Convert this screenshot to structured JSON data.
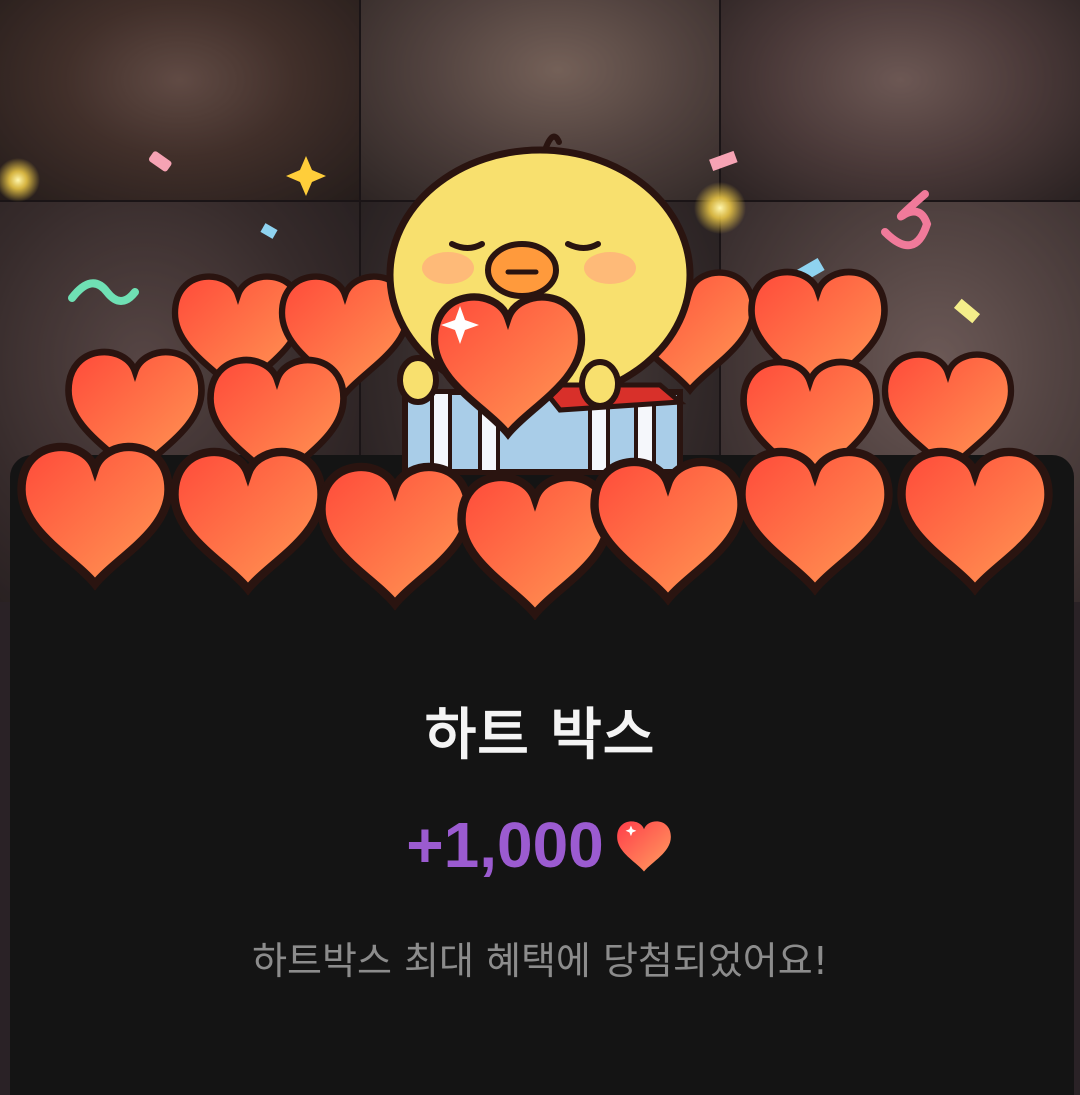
{
  "popup": {
    "title": "하트 박스",
    "reward_amount": "+1,000",
    "message": "하트박스 최대 혜택에 당첨되었어요!"
  },
  "icons": {
    "reward_icon": "heart-icon",
    "mascot": "yellow-chick-mascot"
  },
  "colors": {
    "accent": "#9b5bd0",
    "heart": "#ff6a3d",
    "sheet_bg": "#141414"
  }
}
